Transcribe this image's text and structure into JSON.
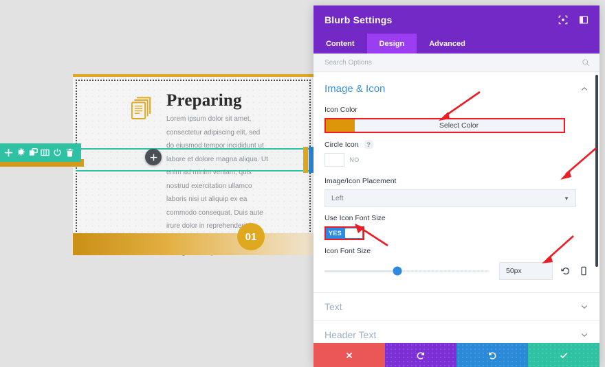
{
  "panel": {
    "title": "Blurb Settings",
    "header_icons": [
      {
        "name": "fullscreen-icon"
      },
      {
        "name": "panel-layout-icon"
      }
    ],
    "tabs": [
      {
        "label": "Content",
        "active": false
      },
      {
        "label": "Design",
        "active": true
      },
      {
        "label": "Advanced",
        "active": false
      }
    ],
    "search": {
      "placeholder": "Search Options",
      "value": "",
      "icon": "search-icon"
    },
    "section": {
      "title": "Image & Icon",
      "collapse_icon": "chevron-up-icon"
    },
    "fields": {
      "icon_color": {
        "label": "Icon Color",
        "button_label": "Select Color",
        "swatch_hex": "#dd9609"
      },
      "circle_icon": {
        "label": "Circle Icon",
        "help": "?",
        "toggle_value": "NO",
        "state": "off"
      },
      "placement": {
        "label": "Image/Icon Placement",
        "value": "Left",
        "caret_icon": "caret-down-icon"
      },
      "use_icon_font_size": {
        "label": "Use Icon Font Size",
        "toggle_value": "YES",
        "state": "on"
      },
      "icon_font_size": {
        "label": "Icon Font Size",
        "value": "50px",
        "slider_percent": 44,
        "reset_icon": "reset-icon",
        "responsive_icon": "mobile-icon"
      }
    },
    "accordions": [
      {
        "label": "Text",
        "icon": "chevron-down-icon"
      },
      {
        "label": "Header Text",
        "icon": "chevron-down-icon"
      }
    ],
    "footer_buttons": [
      {
        "name": "cancel-button",
        "icon": "close-icon",
        "color": "#eb5757"
      },
      {
        "name": "undo-button",
        "icon": "undo-icon",
        "color": "#7b2fd4"
      },
      {
        "name": "redo-button",
        "icon": "redo-icon",
        "color": "#2a8ad8"
      },
      {
        "name": "save-button",
        "icon": "check-icon",
        "color": "#2ec2a3"
      }
    ]
  },
  "canvas": {
    "blurb": {
      "icon": "documents-stack-icon",
      "icon_color": "#e0a81e",
      "title": "Preparing",
      "body": "Lorem ipsum dolor sit amet, consectetur adipiscing elit, sed do eiusmod tempor incididunt ut labore et dolore magna aliqua. Ut enim ad minim veniam, quis nostrud exercitation ullamco laboris nisi ut aliquip ex ea commodo consequat. Duis aute irure dolor in reprehenderit in voluptate velit esse cillum dolore eu fugiat nulla pariatur."
    },
    "badge": "01",
    "module_toolbar": [
      {
        "name": "add-module-icon",
        "icon": "plus-icon"
      },
      {
        "name": "module-settings-icon",
        "icon": "gear-icon"
      },
      {
        "name": "duplicate-module-icon",
        "icon": "duplicate-icon"
      },
      {
        "name": "column-layout-icon",
        "icon": "columns-icon"
      },
      {
        "name": "disable-module-icon",
        "icon": "power-icon"
      },
      {
        "name": "delete-module-icon",
        "icon": "trash-icon"
      }
    ],
    "add_button": {
      "name": "add-row-button",
      "icon": "plus-icon"
    }
  }
}
